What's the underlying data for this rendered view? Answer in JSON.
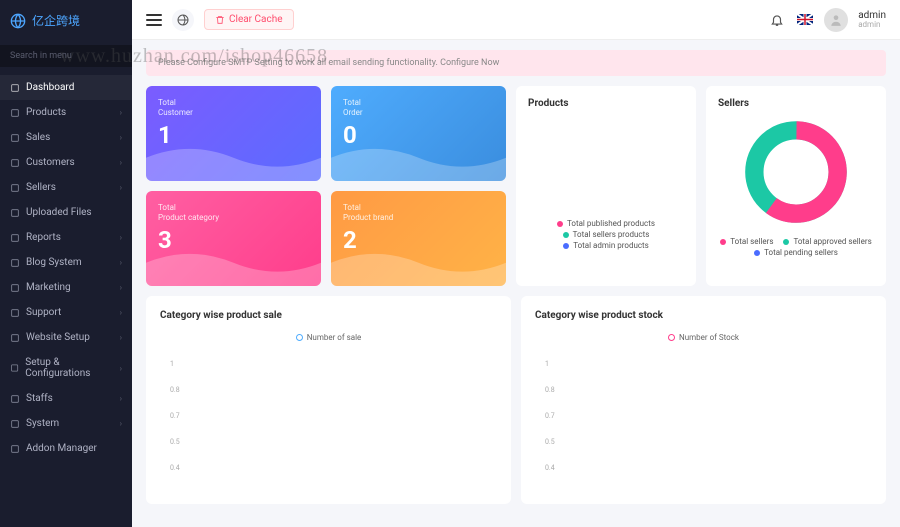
{
  "brand": "亿企跨境",
  "search_placeholder": "Search in menu",
  "nav": [
    {
      "label": "Dashboard",
      "active": true,
      "chev": false
    },
    {
      "label": "Products",
      "chev": true
    },
    {
      "label": "Sales",
      "chev": true
    },
    {
      "label": "Customers",
      "chev": true
    },
    {
      "label": "Sellers",
      "chev": true
    },
    {
      "label": "Uploaded Files",
      "chev": false
    },
    {
      "label": "Reports",
      "chev": true
    },
    {
      "label": "Blog System",
      "chev": true
    },
    {
      "label": "Marketing",
      "chev": true
    },
    {
      "label": "Support",
      "chev": true
    },
    {
      "label": "Website Setup",
      "chev": true
    },
    {
      "label": "Setup & Configurations",
      "chev": true
    },
    {
      "label": "Staffs",
      "chev": true
    },
    {
      "label": "System",
      "chev": true
    },
    {
      "label": "Addon Manager",
      "chev": false
    }
  ],
  "clear_cache": "Clear Cache",
  "user": {
    "name": "admin",
    "role": "admin"
  },
  "pinkbar_text": "Please Configure SMTP Setting to work all email sending functionality. Configure Now",
  "watermark": "www.huzhan.com/ishop46658",
  "stats": [
    {
      "label1": "Total",
      "label2": "Customer",
      "value": "1"
    },
    {
      "label1": "Total",
      "label2": "Order",
      "value": "0"
    },
    {
      "label1": "Total",
      "label2": "Product category",
      "value": "3"
    },
    {
      "label1": "Total",
      "label2": "Product brand",
      "value": "2"
    }
  ],
  "products_card": {
    "title": "Products",
    "legend": [
      {
        "color": "#ff3d8b",
        "label": "Total published products"
      },
      {
        "color": "#1cc8a5",
        "label": "Total sellers products"
      },
      {
        "color": "#4a6cff",
        "label": "Total admin products"
      }
    ]
  },
  "sellers_card": {
    "title": "Sellers",
    "legend": [
      {
        "color": "#ff3d8b",
        "label": "Total sellers"
      },
      {
        "color": "#1cc8a5",
        "label": "Total approved sellers"
      },
      {
        "color": "#4a6cff",
        "label": "Total pending sellers"
      }
    ]
  },
  "chart_data": [
    {
      "type": "line",
      "title": "Category wise product sale",
      "series": [
        {
          "name": "Number of sale",
          "color": "#4facfe",
          "values": []
        }
      ],
      "ylim": [
        0,
        1.0
      ],
      "yticks": [
        1.0,
        0.8,
        0.7,
        0.5,
        0.4
      ]
    },
    {
      "type": "line",
      "title": "Category wise product stock",
      "series": [
        {
          "name": "Number of Stock",
          "color": "#ff3d8b",
          "values": []
        }
      ],
      "ylim": [
        0,
        1.0
      ],
      "yticks": [
        1.0,
        0.8,
        0.7,
        0.5,
        0.4
      ]
    },
    {
      "type": "pie",
      "title": "Sellers",
      "series": [
        {
          "name": "Total sellers",
          "color": "#ff3d8b",
          "value": 60
        },
        {
          "name": "Total approved sellers",
          "color": "#1cc8a5",
          "value": 40
        },
        {
          "name": "Total pending sellers",
          "color": "#4a6cff",
          "value": 0
        }
      ]
    }
  ]
}
